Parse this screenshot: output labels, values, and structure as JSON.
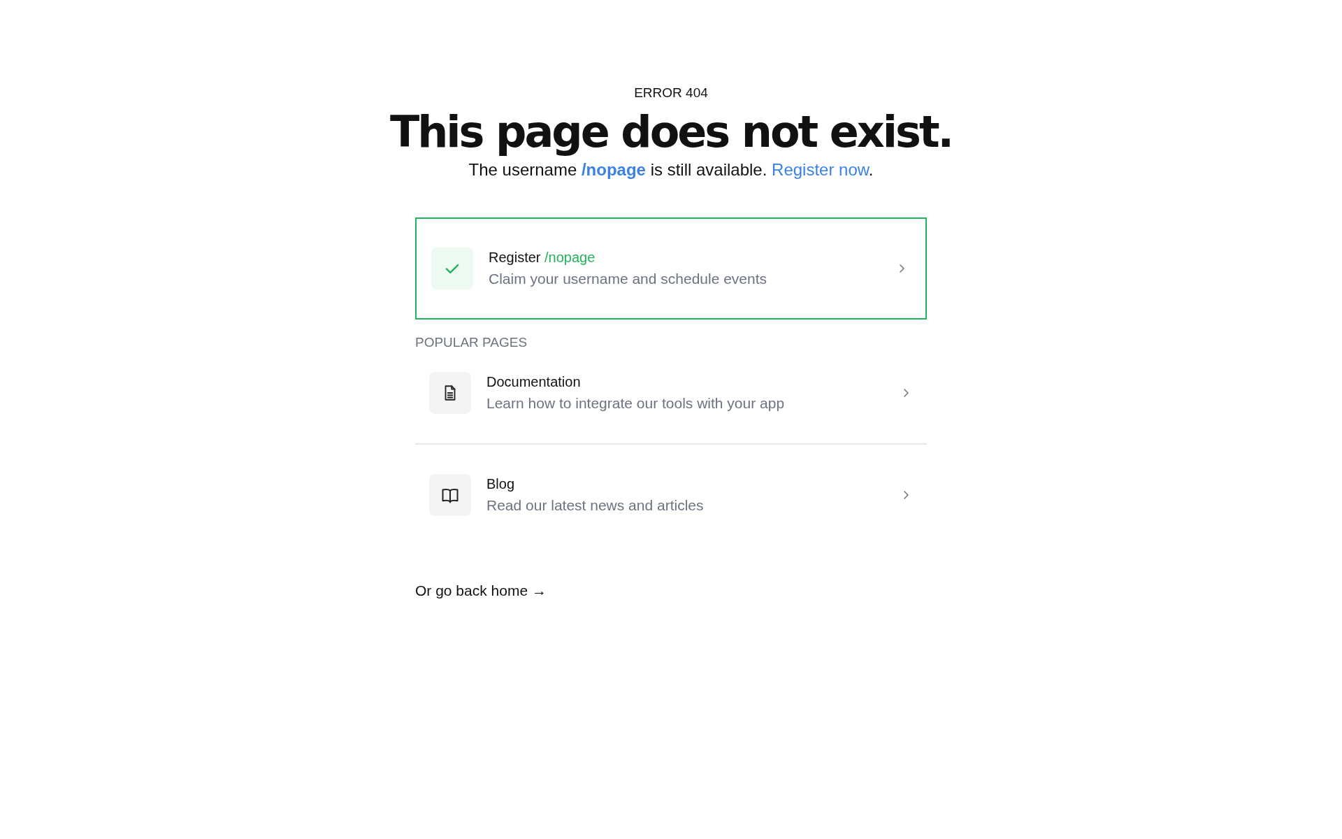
{
  "eyebrow": "ERROR 404",
  "title": "This page does not exist.",
  "subtitle": {
    "before": "The username ",
    "username": "/nopage",
    "middle": " is still available. ",
    "link": "Register now",
    "after": "."
  },
  "register_card": {
    "title": "Register",
    "username": "/nopage",
    "description": "Claim your username and schedule events",
    "selected": true
  },
  "popular_pages": {
    "heading": "POPULAR PAGES",
    "items": [
      {
        "kind": "document",
        "title": "Documentation",
        "description": "Learn how to integrate our tools with your app"
      },
      {
        "kind": "book",
        "title": "Blog",
        "description": "Read our latest news and articles"
      }
    ]
  },
  "home_link": "Or go back home →"
}
